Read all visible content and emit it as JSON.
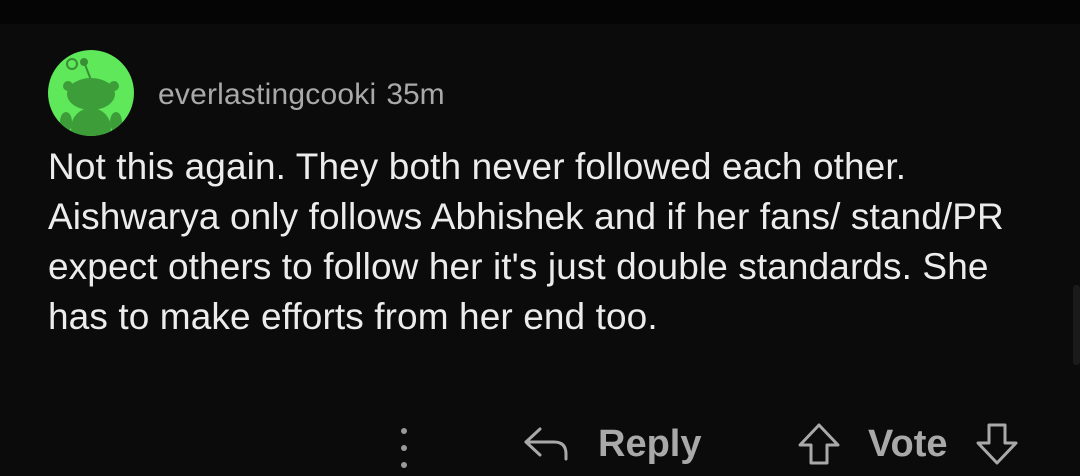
{
  "comment": {
    "author": "everlastingcooki",
    "age": "35m",
    "avatar_color": "#5ee85a",
    "body": "Not this again. They both never followed each other. Aishwarya only follows Abhishek and if her fans/ stand/PR expect others to follow her it's just double standards. She has to make efforts from her end too."
  },
  "actions": {
    "more_icon": "vertical-ellipsis-icon",
    "reply_icon": "reply-arrow-icon",
    "reply_label": "Reply",
    "upvote_icon": "upvote-arrow-icon",
    "vote_label": "Vote",
    "downvote_icon": "downvote-arrow-icon"
  },
  "colors": {
    "background": "#0b0b0b",
    "text_primary": "#ececec",
    "text_secondary": "#a9a9a9"
  }
}
